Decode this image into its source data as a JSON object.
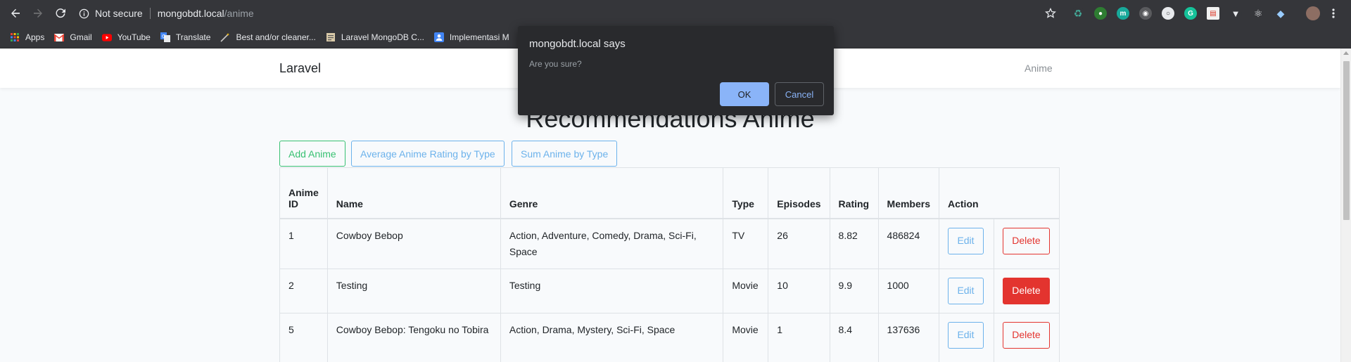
{
  "browser": {
    "security_label": "Not secure",
    "url_host": "mongobdt.local",
    "url_path": "/anime"
  },
  "bookmarks": [
    {
      "label": "Apps",
      "icon": "apps-grid-icon"
    },
    {
      "label": "Gmail",
      "icon": "gmail-icon"
    },
    {
      "label": "YouTube",
      "icon": "youtube-icon"
    },
    {
      "label": "Translate",
      "icon": "translate-icon"
    },
    {
      "label": "Best and/or cleaner...",
      "icon": "wand-icon"
    },
    {
      "label": "Laravel MongoDB C...",
      "icon": "page-icon"
    },
    {
      "label": "Implementasi M",
      "icon": "contact-icon"
    }
  ],
  "navbar": {
    "brand": "Laravel",
    "link": "Anime"
  },
  "page": {
    "title": "Recommendations Anime",
    "buttons": {
      "add": "Add Anime",
      "average": "Average Anime Rating by Type",
      "sum": "Sum Anime by Type"
    }
  },
  "table": {
    "headers": {
      "anime_id_1": "Anime",
      "anime_id_2": "ID",
      "name": "Name",
      "genre": "Genre",
      "type": "Type",
      "episodes": "Episodes",
      "rating": "Rating",
      "members": "Members",
      "action": "Action"
    },
    "rows": [
      {
        "id": "1",
        "name": "Cowboy Bebop",
        "genre": "Action, Adventure, Comedy, Drama, Sci-Fi, Space",
        "type": "TV",
        "episodes": "26",
        "rating": "8.82",
        "members": "486824",
        "edit": "Edit",
        "delete": "Delete"
      },
      {
        "id": "2",
        "name": "Testing",
        "genre": "Testing",
        "type": "Movie",
        "episodes": "10",
        "rating": "9.9",
        "members": "1000",
        "edit": "Edit",
        "delete": "Delete"
      },
      {
        "id": "5",
        "name": "Cowboy Bebop: Tengoku no Tobira",
        "genre": "Action, Drama, Mystery, Sci-Fi, Space",
        "type": "Movie",
        "episodes": "1",
        "rating": "8.4",
        "members": "137636",
        "edit": "Edit",
        "delete": "Delete"
      }
    ]
  },
  "dialog": {
    "title": "mongobdt.local says",
    "message": "Are you sure?",
    "ok": "OK",
    "cancel": "Cancel"
  },
  "colors": {
    "green": "#38c172",
    "blue": "#6cb2eb",
    "red": "#e3342f",
    "dialog_bg": "#292a2d",
    "dialog_accent": "#8ab4f8"
  }
}
